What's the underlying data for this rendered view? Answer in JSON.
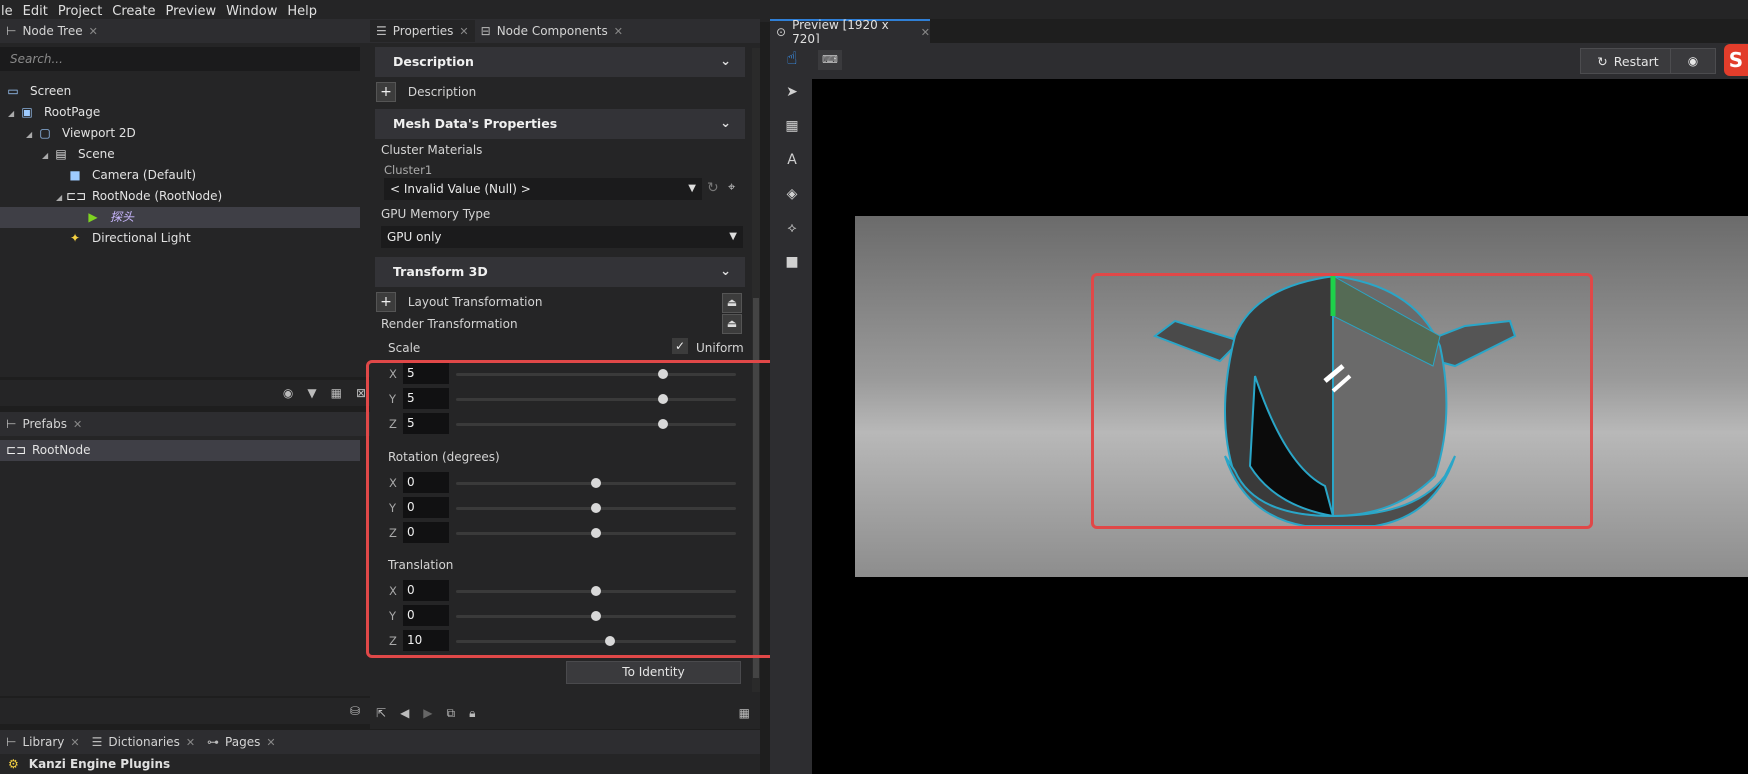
{
  "menu": [
    "le",
    "Edit",
    "Project",
    "Create",
    "Preview",
    "Window",
    "Help"
  ],
  "node_tree": {
    "tab": "Node Tree",
    "search_placeholder": "Search...",
    "items": [
      {
        "label": "Screen",
        "indent": 0,
        "icon": "screen-icon"
      },
      {
        "label": "RootPage",
        "indent": 1,
        "icon": "page-icon"
      },
      {
        "label": "Viewport 2D",
        "indent": 2,
        "icon": "viewport-icon"
      },
      {
        "label": "Scene",
        "indent": 3,
        "icon": "scene-icon"
      },
      {
        "label": "Camera (Default)",
        "indent": 4,
        "icon": "camera-icon"
      },
      {
        "label": "RootNode (RootNode)",
        "indent": 4,
        "icon": "node-icon"
      },
      {
        "label": "探头",
        "indent": 5,
        "icon": "model-icon"
      },
      {
        "label": "Directional Light",
        "indent": 4,
        "icon": "light-icon"
      }
    ]
  },
  "prefabs": {
    "tab": "Prefabs",
    "items": [
      "RootNode"
    ]
  },
  "library": {
    "tabs": [
      "Library",
      "Dictionaries",
      "Pages"
    ],
    "heading": "Kanzi Engine Plugins"
  },
  "properties": {
    "tabs": [
      "Properties",
      "Node Components"
    ],
    "description": {
      "header": "Description",
      "add_label": "Description"
    },
    "mesh": {
      "header": "Mesh Data's Properties",
      "cluster_materials": "Cluster Materials",
      "cluster1": "Cluster1",
      "cluster_value": "< Invalid Value (Null) >",
      "gpu_label": "GPU Memory Type",
      "gpu_value": "GPU only"
    },
    "transform": {
      "header": "Transform 3D",
      "layout": "Layout Transformation",
      "render": "Render Transformation",
      "scale_label": "Scale",
      "uniform_label": "Uniform",
      "scale": {
        "x": "5",
        "y": "5",
        "z": "5",
        "slider": [
          0.74,
          0.74,
          0.74
        ]
      },
      "rotation_label": "Rotation (degrees)",
      "rotation": {
        "x": "0",
        "y": "0",
        "z": "0",
        "slider": [
          0.5,
          0.5,
          0.5
        ]
      },
      "translation_label": "Translation",
      "translation": {
        "x": "0",
        "y": "0",
        "z": "10",
        "slider": [
          0.5,
          0.5,
          0.55
        ]
      },
      "identity_button": "To Identity"
    }
  },
  "preview": {
    "tab": "Preview [1920 x 720]",
    "restart": "Restart"
  },
  "colors": {
    "accent": "#2f7fd6",
    "highlight": "#e04848",
    "selection": "#3f3f46"
  }
}
